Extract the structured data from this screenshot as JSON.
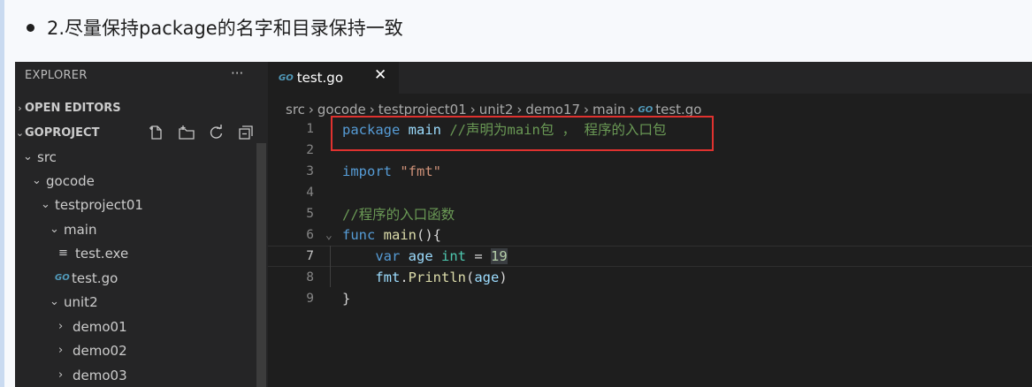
{
  "doc": {
    "heading": "2.尽量保持package的名字和目录保持一致"
  },
  "explorer": {
    "title": "EXPLORER",
    "more": "···",
    "open_editors": "OPEN EDITORS",
    "workspace": "GOPROJECT",
    "tree": [
      {
        "label": "src",
        "kind": "folder-open"
      },
      {
        "label": "gocode",
        "kind": "folder-open"
      },
      {
        "label": "testproject01",
        "kind": "folder-open"
      },
      {
        "label": "main",
        "kind": "folder-open"
      },
      {
        "label": "test.exe",
        "kind": "file-exe"
      },
      {
        "label": "test.go",
        "kind": "file-go"
      },
      {
        "label": "unit2",
        "kind": "folder-open"
      },
      {
        "label": "demo01",
        "kind": "folder-closed"
      },
      {
        "label": "demo02",
        "kind": "folder-closed"
      },
      {
        "label": "demo03",
        "kind": "folder-closed"
      }
    ],
    "icons": [
      "new-file-icon",
      "new-folder-icon",
      "refresh-icon",
      "collapse-all-icon"
    ]
  },
  "tab": {
    "label": "test.go",
    "icon": "GO",
    "close": "✕"
  },
  "breadcrumb": [
    "src",
    "gocode",
    "testproject01",
    "unit2",
    "demo17",
    "main",
    "test.go"
  ],
  "code": {
    "line_numbers": [
      "1",
      "2",
      "3",
      "4",
      "5",
      "6",
      "7",
      "8",
      "9"
    ],
    "active_line": 7,
    "lines": [
      "package main //声明为main包 ， 程序的入口包",
      "",
      "import \"fmt\"",
      "",
      "//程序的入口函数",
      "func main(){",
      "    var age int = 19",
      "    fmt.Println(age)",
      "}"
    ]
  },
  "colors": {
    "highlight_box": "#e0322f",
    "go_icon": "#519aba",
    "keyword": "#569cd6",
    "comment": "#6a9955"
  }
}
